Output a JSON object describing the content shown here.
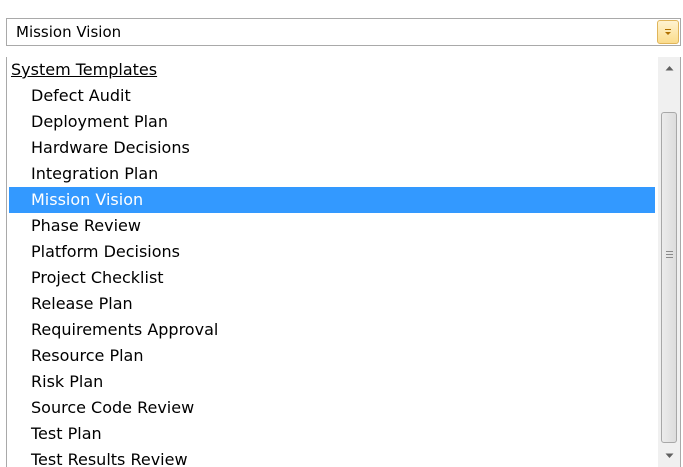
{
  "combo": {
    "selected_value": "Mission Vision",
    "button_icon": "chevron-down-icon"
  },
  "dropdown": {
    "group": {
      "header": "System Templates",
      "items": [
        {
          "label": "Defect Audit",
          "selected": false
        },
        {
          "label": "Deployment Plan",
          "selected": false
        },
        {
          "label": "Hardware Decisions",
          "selected": false
        },
        {
          "label": "Integration Plan",
          "selected": false
        },
        {
          "label": "Mission Vision",
          "selected": true
        },
        {
          "label": "Phase Review",
          "selected": false
        },
        {
          "label": "Platform Decisions",
          "selected": false
        },
        {
          "label": "Project Checklist",
          "selected": false
        },
        {
          "label": "Release Plan",
          "selected": false
        },
        {
          "label": "Requirements Approval",
          "selected": false
        },
        {
          "label": "Resource Plan",
          "selected": false
        },
        {
          "label": "Risk Plan",
          "selected": false
        },
        {
          "label": "Source Code Review",
          "selected": false
        },
        {
          "label": "Test Plan",
          "selected": false
        },
        {
          "label": "Test Results Review",
          "selected": false
        }
      ]
    },
    "scrollbar": {
      "up_icon": "scroll-up-arrow-icon",
      "down_icon": "scroll-down-arrow-icon",
      "grip_icon": "scroll-grip-icon"
    }
  },
  "colors": {
    "selection": "#3399ff",
    "button_border": "#e0b55a",
    "button_fill": "#fbdc8c"
  }
}
